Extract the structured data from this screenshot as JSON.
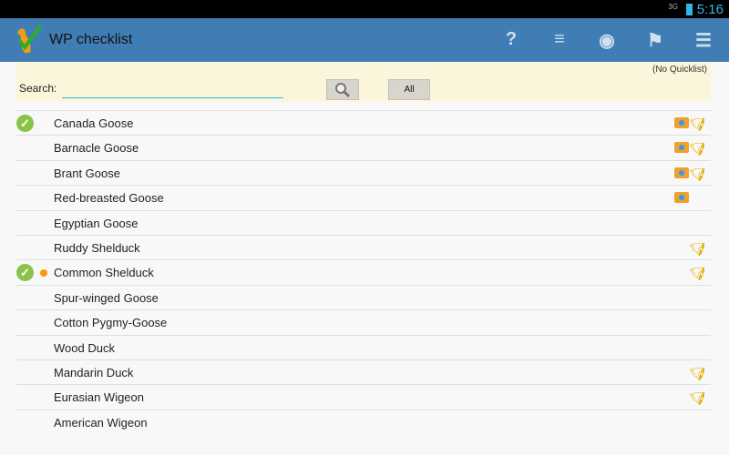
{
  "status": {
    "network": "3G",
    "time": "5:16"
  },
  "app": {
    "title": "WP checklist"
  },
  "actions": [
    {
      "name": "help",
      "glyph": "?"
    },
    {
      "name": "sort",
      "glyph": "≡"
    },
    {
      "name": "view",
      "glyph": "◉"
    },
    {
      "name": "observer",
      "glyph": "⚑"
    },
    {
      "name": "account",
      "glyph": "☰"
    }
  ],
  "panel": {
    "quicklist": "(No Quicklist)",
    "search_label": "Search:",
    "search_value": "",
    "all_label": "All"
  },
  "birds": [
    {
      "name": "Canada Goose",
      "checked": true,
      "dot": false,
      "photo": true,
      "sound": true
    },
    {
      "name": "Barnacle Goose",
      "checked": false,
      "dot": false,
      "photo": true,
      "sound": true
    },
    {
      "name": "Brant Goose",
      "checked": false,
      "dot": false,
      "photo": true,
      "sound": true
    },
    {
      "name": "Red-breasted Goose",
      "checked": false,
      "dot": false,
      "photo": true,
      "sound": false
    },
    {
      "name": "Egyptian Goose",
      "checked": false,
      "dot": false,
      "photo": false,
      "sound": false
    },
    {
      "name": "Ruddy Shelduck",
      "checked": false,
      "dot": false,
      "photo": false,
      "sound": true
    },
    {
      "name": "Common Shelduck",
      "checked": true,
      "dot": true,
      "photo": false,
      "sound": true
    },
    {
      "name": "Spur-winged Goose",
      "checked": false,
      "dot": false,
      "photo": false,
      "sound": false
    },
    {
      "name": "Cotton Pygmy-Goose",
      "checked": false,
      "dot": false,
      "photo": false,
      "sound": false
    },
    {
      "name": "Wood Duck",
      "checked": false,
      "dot": false,
      "photo": false,
      "sound": false
    },
    {
      "name": "Mandarin Duck",
      "checked": false,
      "dot": false,
      "photo": false,
      "sound": true
    },
    {
      "name": "Eurasian Wigeon",
      "checked": false,
      "dot": false,
      "photo": false,
      "sound": true
    },
    {
      "name": "American Wigeon",
      "checked": false,
      "dot": false,
      "photo": false,
      "sound": false
    }
  ]
}
